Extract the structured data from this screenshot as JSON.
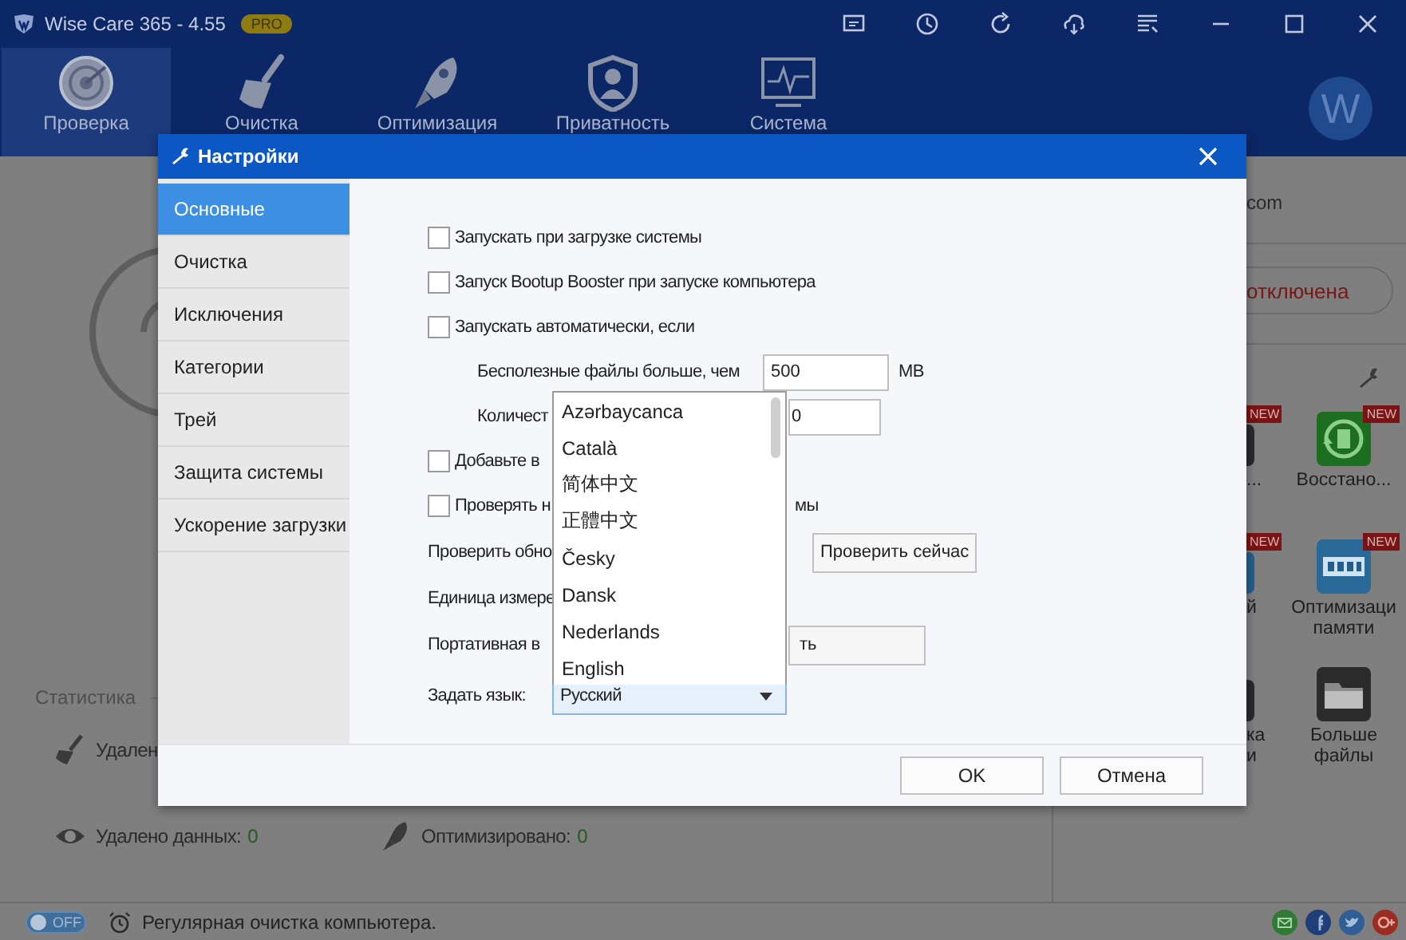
{
  "window": {
    "title": "Wise Care 365 - 4.55",
    "badge": "PRO"
  },
  "nav": [
    {
      "label": "Проверка",
      "selected": true
    },
    {
      "label": "Очистка",
      "selected": false
    },
    {
      "label": "Оптимизация",
      "selected": false
    },
    {
      "label": "Приватность",
      "selected": false
    },
    {
      "label": "Система",
      "selected": false
    }
  ],
  "avatar": {
    "letter": "W"
  },
  "statistics": {
    "title": "Статистика",
    "rows": [
      {
        "label": "Удален"
      },
      {
        "label": "Удалено данных:",
        "value": "0"
      },
      {
        "label": "Оптимизировано:",
        "value": "0"
      }
    ]
  },
  "right_panel": {
    "site": "com",
    "status": "отключена",
    "tools": [
      {
        "label": "...",
        "badge": "NEW",
        "color": "#2b2b2b"
      },
      {
        "label": "Восстано...",
        "badge": "NEW",
        "color": "#1e6e22"
      },
      {
        "label": "й",
        "badge": "NEW",
        "color": "#245f8c"
      },
      {
        "label": "Оптимизаци памяти",
        "badge": "NEW",
        "color": "#2a6a99"
      },
      {
        "label": "ка и",
        "color": "#2b2b2b"
      },
      {
        "label": "Больше файлы",
        "color": "#2b2b2b"
      }
    ]
  },
  "status_bar": {
    "toggle": {
      "label": "OFF",
      "on": false
    },
    "text": "Регулярная очистка компьютера."
  },
  "dialog": {
    "title": "Настройки",
    "sidebar": [
      {
        "label": "Основные",
        "selected": true
      },
      {
        "label": "Очистка",
        "selected": false
      },
      {
        "label": "Исключения",
        "selected": false
      },
      {
        "label": "Категории",
        "selected": false
      },
      {
        "label": "Трей",
        "selected": false
      },
      {
        "label": "Защита системы",
        "selected": false
      },
      {
        "label": "Ускорение загрузки",
        "selected": false
      }
    ],
    "settings": [
      {
        "kind": "checkbox",
        "label": "Запускать при загрузке системы",
        "checked": false
      },
      {
        "kind": "checkbox",
        "label": "Запуск Bootup Booster при запуске компьютера",
        "checked": false
      },
      {
        "kind": "checkbox",
        "label": "Запускать автоматически, если",
        "checked": false
      },
      {
        "kind": "field",
        "label": "Бесполезные файлы больше, чем",
        "value": "500",
        "unit": "MB"
      },
      {
        "kind": "field",
        "label": "Количест",
        "value": "0"
      },
      {
        "kind": "checkbox",
        "label": "Добавьте в",
        "checked": false
      },
      {
        "kind": "checkbox",
        "label": "Проверять н",
        "checked": false,
        "tail": "мы"
      },
      {
        "kind": "button",
        "label": "Проверить обно",
        "button": "Проверить сейчас"
      },
      {
        "kind": "text",
        "label": "Единица измере"
      },
      {
        "kind": "wide_button",
        "label": "Портативная в",
        "button": "ть"
      },
      {
        "kind": "select",
        "label": "Задать язык:",
        "value": "Русский"
      }
    ],
    "languages": [
      "Azərbaycanca",
      "Català",
      "简体中文",
      "正體中文",
      "Česky",
      "Dansk",
      "Nederlands",
      "English"
    ],
    "buttons": [
      "OK",
      "Отмена"
    ]
  }
}
